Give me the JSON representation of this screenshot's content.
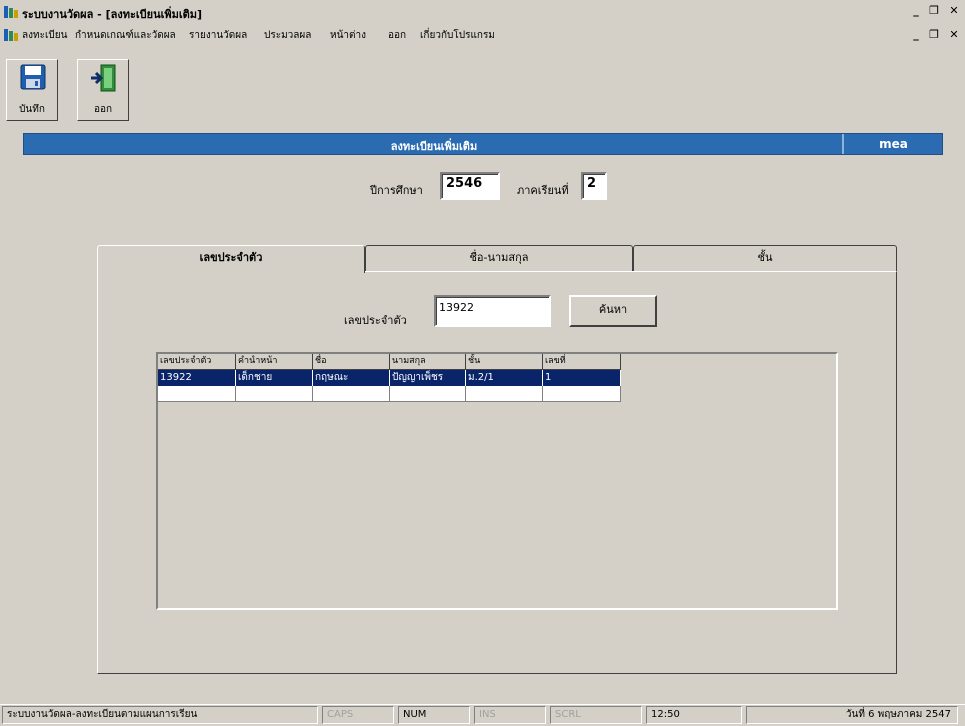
{
  "window": {
    "title": "ระบบงานวัดผล - [ลงทะเบียนเพิ่มเติม]",
    "controls": {
      "minimize": "_",
      "restore": "❐",
      "close": "✕"
    }
  },
  "menu": {
    "items": [
      "ลงทะเบียน",
      "กำหนดเกณฑ์และวัดผล",
      "รายงานวัดผล",
      "ประมวลผล",
      "หน้าต่าง",
      "ออก",
      "เกี่ยวกับโปรแกรม"
    ]
  },
  "toolbar": {
    "save_label": "บันทึก",
    "exit_label": "ออก"
  },
  "header": {
    "title": "ลงทะเบียนเพิ่มเติม",
    "user": "mea"
  },
  "term": {
    "year_label": "ปีการศึกษา",
    "year_value": "2546",
    "semester_label": "ภาคเรียนที่",
    "semester_value": "2"
  },
  "tabs": [
    "เลขประจำตัว",
    "ชื่อ-นามสกุล",
    "ชั้น"
  ],
  "search": {
    "label": "เลขประจำตัว",
    "value": "13922",
    "button": "ค้นหา"
  },
  "grid": {
    "columns": [
      "เลขประจำตัว",
      "คำนำหน้า",
      "ชื่อ",
      "นามสกุล",
      "ชั้น",
      "เลขที่"
    ],
    "rows": [
      [
        "13922",
        "เด็กชาย",
        "กฤษณะ",
        "ปัญญาเพ็ชร",
        "ม.2/1",
        "1"
      ]
    ]
  },
  "statusbar": {
    "message": "ระบบงานวัดผล-ลงทะเบียนตามแผนการเรียน",
    "caps": "CAPS",
    "num": "NUM",
    "ins": "INS",
    "scrl": "SCRL",
    "time": "12:50",
    "date": "วันที่ 6 พฤษภาคม 2547"
  },
  "colors": {
    "header_bg": "#2a6bb2",
    "selection_bg": "#0a246a",
    "window_bg": "#d4d0c8"
  }
}
